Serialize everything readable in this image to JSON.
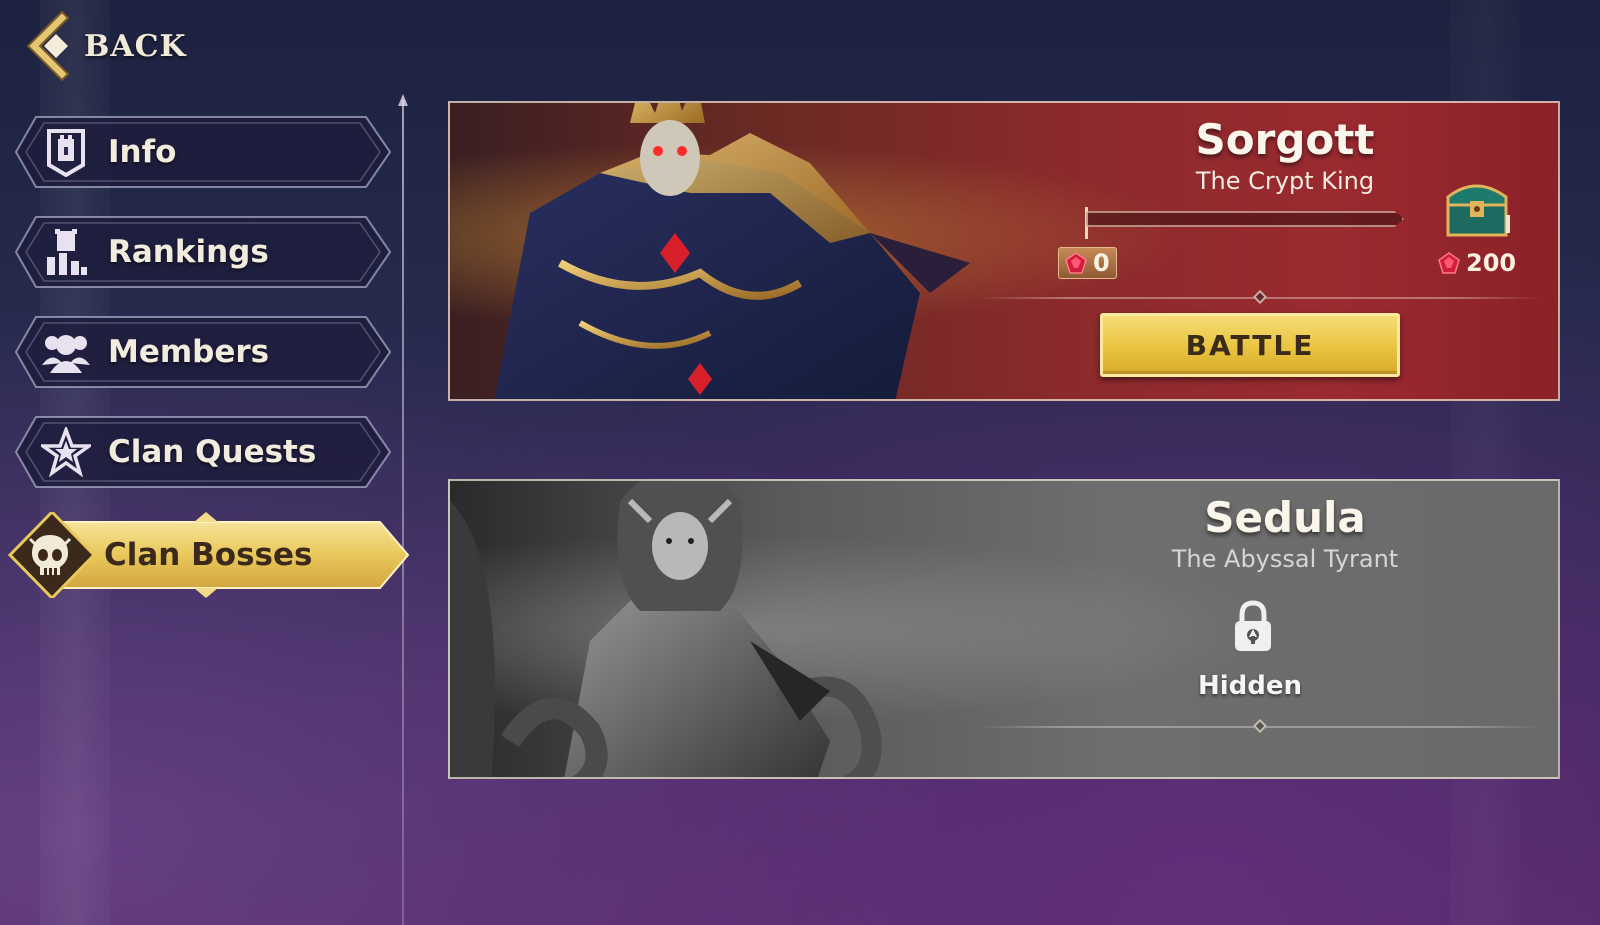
{
  "header": {
    "back_label": "BACK"
  },
  "sidebar": {
    "items": [
      {
        "label": "Info",
        "icon": "banner-tower-icon",
        "active": false
      },
      {
        "label": "Rankings",
        "icon": "rankings-tower-icon",
        "active": false
      },
      {
        "label": "Members",
        "icon": "members-icon",
        "active": false
      },
      {
        "label": "Clan Quests",
        "icon": "star-icon",
        "active": false
      },
      {
        "label": "Clan Bosses",
        "icon": "skull-emblem-icon",
        "active": true
      }
    ]
  },
  "bosses": [
    {
      "name": "Sorgott",
      "title": "The Crypt King",
      "progress": {
        "current": "0",
        "target": "200",
        "fraction": 0.0
      },
      "reward_icon": "treasure-chest-icon",
      "currency_icon": "red-gem-icon",
      "action_label": "BATTLE",
      "locked": false
    },
    {
      "name": "Sedula",
      "title": "The Abyssal Tyrant",
      "status_label": "Hidden",
      "status_icon": "padlock-icon",
      "locked": true
    }
  ],
  "colors": {
    "active_tab": "#e9c85a",
    "battle_button": "#ecc84a",
    "sorgott_card": "#8a2a2c",
    "sedula_card": "#5e5e5e"
  }
}
